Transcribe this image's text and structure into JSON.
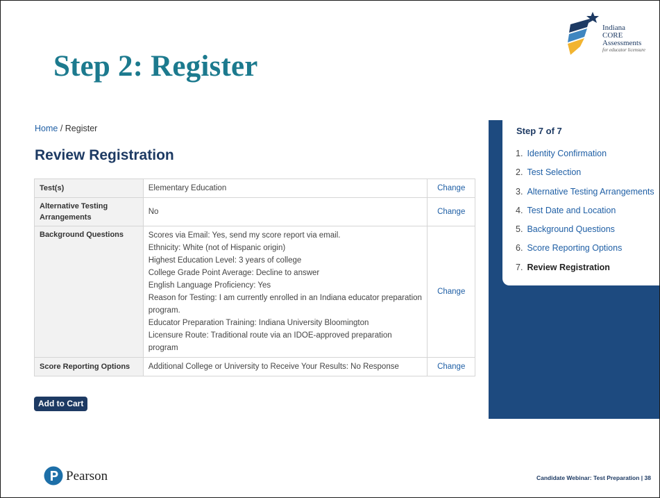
{
  "slide": {
    "title": "Step 2: Register",
    "footer_text": "Candidate Webinar: Test Preparation | 38",
    "brand_text": "Pearson",
    "logo": {
      "line1": "Indiana",
      "line2": "CORE",
      "line3": "Assessments",
      "line4": "for educator licensure"
    }
  },
  "breadcrumb": {
    "home": "Home",
    "separator": " / ",
    "current": "Register"
  },
  "heading": "Review Registration",
  "review": {
    "change_label": "Change",
    "rows": [
      {
        "label": "Test(s)",
        "value": "Elementary Education"
      },
      {
        "label": "Alternative Testing Arrangements",
        "value": "No"
      },
      {
        "label": "Background Questions",
        "lines": [
          "Scores via Email: Yes, send my score report via email.",
          "Ethnicity: White (not of Hispanic origin)",
          "Highest Education Level: 3 years of college",
          "College Grade Point Average: Decline to answer",
          "English Language Proficiency: Yes",
          "Reason for Testing: I am currently enrolled in an Indiana educator preparation program.",
          "Educator Preparation Training: Indiana University Bloomington",
          "Licensure Route: Traditional route via an IDOE-approved preparation program"
        ]
      },
      {
        "label": "Score Reporting Options",
        "value": "Additional College or University to Receive Your Results: No Response"
      }
    ]
  },
  "add_to_cart_label": "Add to Cart",
  "steps": {
    "title": "Step 7 of 7",
    "items": [
      {
        "num": "1.",
        "label": "Identity Confirmation"
      },
      {
        "num": "2.",
        "label": "Test Selection"
      },
      {
        "num": "3.",
        "label": "Alternative Testing Arrangements"
      },
      {
        "num": "4.",
        "label": "Test Date and Location"
      },
      {
        "num": "5.",
        "label": "Background Questions"
      },
      {
        "num": "6.",
        "label": "Score Reporting Options"
      },
      {
        "num": "7.",
        "label": "Review Registration"
      }
    ],
    "current_index": 6
  },
  "colors": {
    "title": "#1c7a8e",
    "navy": "#1d3a63",
    "panel": "#1d4a7f",
    "link": "#1f5fa5"
  },
  "icons": [
    "indiana-core-star-logo",
    "pearson-p-logo"
  ]
}
